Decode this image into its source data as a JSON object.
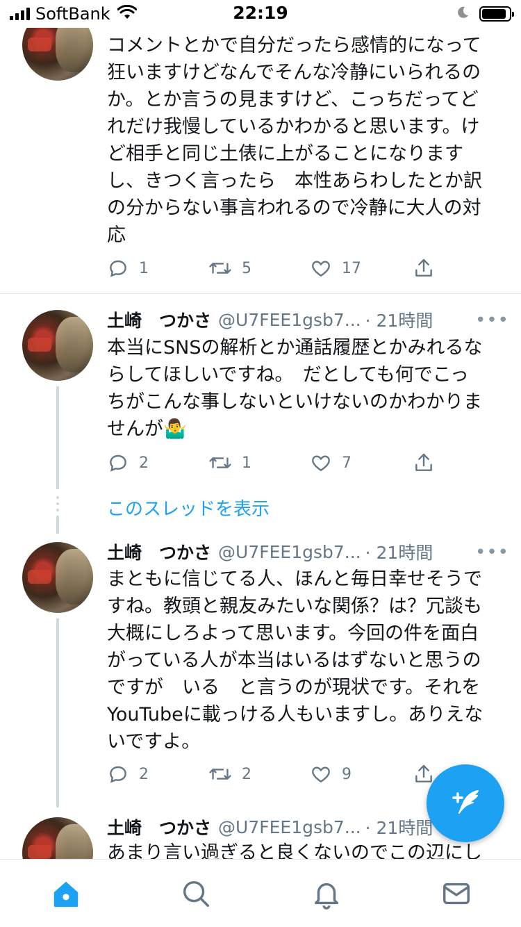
{
  "status_bar": {
    "carrier": "SoftBank",
    "time": "22:19",
    "battery_level": 0.9,
    "icons": [
      "signal-icon",
      "wifi-icon",
      "moon-icon",
      "battery-icon"
    ]
  },
  "tweets": [
    {
      "lines": [
        "コメントとかで自分だったら感情的になって",
        "狂いますけどなんでそんな冷静にいられるの",
        "か。とか言うの見ますけど、こっちだってど",
        "れだけ我慢しているかわかると思います。け",
        "ど相手と同じ土俵に上がることになります",
        "し、きつく言ったら　本性あらわしたとか訳",
        "の分からない事言われるので冷静に大人の対",
        "応"
      ],
      "replies": "1",
      "retweets": "5",
      "likes": "17"
    },
    {
      "name": "土崎　つかさ",
      "handle": "@U7FEE1gsb7...",
      "time": "· 21時間",
      "lines": [
        "本当にSNSの解析とか通話履歴とかみれるな",
        "らしてほしいですね。　だとしても何でこっ",
        "ちがこんな事しないといけないのかわかりま",
        "せんが🤷‍♂️"
      ],
      "replies": "2",
      "retweets": "1",
      "likes": "7"
    },
    {
      "name": "土崎　つかさ",
      "handle": "@U7FEE1gsb7...",
      "time": "· 21時間",
      "lines": [
        "まともに信じてる人、ほんと毎日幸せそうで",
        "すね。教頭と親友みたいな関係？は？冗談も",
        "大概にしろよって思います。今回の件を面白",
        "がっている人が本当はいるはずないと思うの",
        "ですが　いる　と言うのが現状です。それを",
        "YouTubeに載っける人もいますし。ありえな",
        "いですよ。"
      ],
      "replies": "2",
      "retweets": "2",
      "likes": "9"
    },
    {
      "name": "土崎　つかさ",
      "handle": "@U7FEE1gsb7...",
      "time": "· 21時間",
      "lines": [
        "あまり言い過ぎると良くないのでこの辺にし"
      ]
    }
  ],
  "show_thread": "このスレッドを表示",
  "more_glyph": "•••",
  "tabbar": {
    "tabs": [
      "home",
      "search",
      "notifications",
      "messages"
    ],
    "active": "home"
  },
  "colors": {
    "accent": "#1da1f2",
    "text": "#14171a",
    "secondary": "#657786",
    "divider": "#e1e8ed",
    "thread_line": "#cfd9de"
  }
}
